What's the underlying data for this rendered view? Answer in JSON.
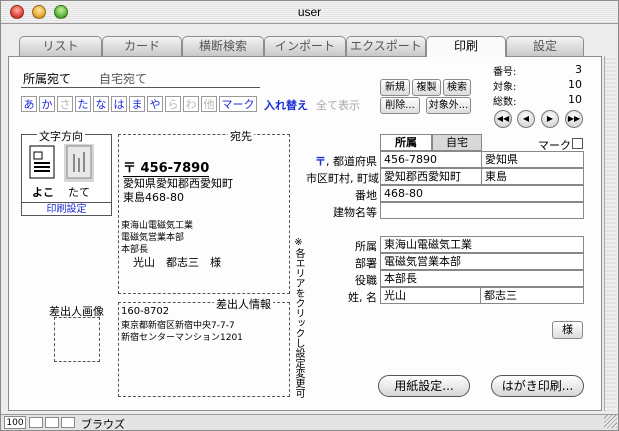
{
  "window": {
    "title": "user"
  },
  "tabs": [
    {
      "label": "リスト"
    },
    {
      "label": "カード"
    },
    {
      "label": "横断検索"
    },
    {
      "label": "インポート"
    },
    {
      "label": "エクスポート"
    },
    {
      "label": "印刷",
      "active": true
    },
    {
      "label": "設定"
    }
  ],
  "address_type": {
    "work": "所属宛て",
    "home": "自宅宛て"
  },
  "kana_filter": {
    "keys": [
      "あ",
      "か",
      "さ",
      "た",
      "な",
      "は",
      "ま",
      "や",
      "ら",
      "わ",
      "他"
    ],
    "disabled": [
      "さ",
      "ら",
      "わ",
      "他"
    ],
    "mark": "マーク",
    "swap": "入れ替え",
    "show_all": "全て表示"
  },
  "toolbar": {
    "new": "新規",
    "duplicate": "複製",
    "search": "検索",
    "delete": "削除...",
    "target_exclude": "対象外..."
  },
  "stats": {
    "number_label": "番号:",
    "number_value": "3",
    "target_label": "対象:",
    "target_value": "10",
    "total_label": "総数:",
    "total_value": "10"
  },
  "text_direction": {
    "legend": "文字方向",
    "horizontal": "よこ",
    "vertical": "たて",
    "print_settings": "印刷設定"
  },
  "recipient": {
    "legend": "宛先",
    "zip": "〒 456-7890",
    "address1": "愛知県愛知郡西愛知町",
    "address2": "東島468-80",
    "company": "東海山電磁気工業",
    "department": "電磁気営業本部",
    "title": "本部長",
    "name": "光山　都志三　様"
  },
  "sender": {
    "image_label": "差出人画像",
    "info_label": "差出人情報",
    "zip": "160-8702",
    "address1": "東京都新宿区新宿中央7-7-7",
    "address2": "新宿センターマンション1201"
  },
  "vertical_note": "※各エリアをクリックし設定変更可",
  "record": {
    "sub_tab_work": "所属",
    "sub_tab_home": "自宅",
    "mark_label": "マーク",
    "rows": [
      {
        "label": "〒, 都道府県",
        "v1": "456-7890",
        "v2": "愛知県"
      },
      {
        "label": "市区町村, 町域",
        "v1": "愛知郡西愛知町",
        "v2": "東島"
      },
      {
        "label": "番地",
        "v1": "468-80"
      },
      {
        "label": "建物名等",
        "v1": ""
      }
    ],
    "org_rows": [
      {
        "label": "所属",
        "v1": "東海山電磁気工業"
      },
      {
        "label": "部署",
        "v1": "電磁気営業本部"
      },
      {
        "label": "役職",
        "v1": "本部長"
      },
      {
        "label": "姓, 名",
        "v1": "光山",
        "v2": "都志三"
      }
    ],
    "honorific": "様"
  },
  "actions": {
    "paper_settings": "用紙設定...",
    "postcard_print": "はがき印刷..."
  },
  "status": {
    "zoom": "100",
    "mode": "ブラウズ"
  }
}
